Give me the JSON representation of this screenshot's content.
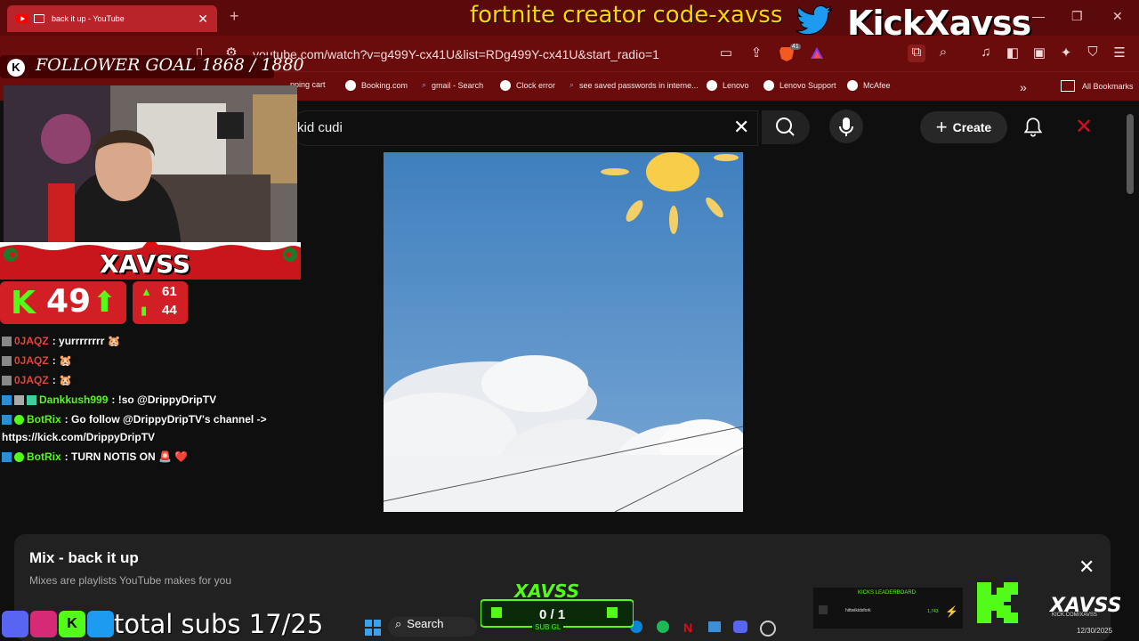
{
  "browser": {
    "tab_title": "back it up - YouTube",
    "tab_close": "✕",
    "new_tab": "+",
    "url": "youtube.com/watch?v=g499Y-cx41U&list=RDg499Y-cx41U&start_radio=1",
    "bookmarks": [
      "pping cart",
      "Booking.com",
      "gmail - Search",
      "Clock error",
      "see saved passwords in interne...",
      "Lenovo",
      "Lenovo Support",
      "McAfee"
    ],
    "all_bookmarks": "All Bookmarks",
    "window_minimize": "—",
    "window_restore": "❐",
    "window_close": "✕",
    "extension_badge": "41"
  },
  "overlay": {
    "creator_code": "fortnite creator code-xavss",
    "kick_name": "KickXavss",
    "follower_goal": "FOLLOWER GOAL 1868 / 1880",
    "banner_name": "XAVSS",
    "stats": {
      "viewers": "49",
      "stat_a": "61",
      "stat_b": "44"
    },
    "chat": [
      {
        "user": "0JAQZ",
        "user_color": "#e8453c",
        "message": ": yurrrrrrrr 🐹"
      },
      {
        "user": "0JAQZ",
        "user_color": "#e8453c",
        "message": ": 🐹"
      },
      {
        "user": "0JAQZ",
        "user_color": "#e8453c",
        "message": ": 🐹"
      },
      {
        "user": "Dankkush999",
        "user_color": "#53fc18",
        "message": ": !so @DrippyDripTV"
      },
      {
        "user": "BotRix",
        "user_color": "#53fc18",
        "message": ": Go follow @DrippyDripTV's channel ->"
      },
      {
        "user": "",
        "user_color": "#ffffff",
        "message": "https://kick.com/DrippyDripTV"
      },
      {
        "user": "BotRix",
        "user_color": "#53fc18",
        "message": ": TURN NOTIS ON 🚨 ❤️"
      }
    ],
    "total_subs": "total subs 17/25",
    "sub_widget_title": "XAVSS",
    "sub_widget_count": "0 / 1",
    "sub_widget_label": "SUB GL",
    "leaderboard_title": "KICKS LEADERBOARD",
    "leaderboard_user": "hittwikidsfork",
    "leaderboard_value": "1,743",
    "bottom_name": "XAVSS",
    "bottom_link": "KICK.COM/XAVSS"
  },
  "youtube": {
    "search_query": "kid cudi",
    "create_label": "Create",
    "mix_title": "Mix - back it up",
    "mix_subtitle": "Mixes are playlists YouTube makes for you"
  },
  "taskbar": {
    "search_label": "Search",
    "date": "12/30/2025"
  },
  "colors": {
    "brand_red": "#c8161c",
    "kick_green": "#53fc18",
    "creator_yellow": "#ffd400"
  }
}
